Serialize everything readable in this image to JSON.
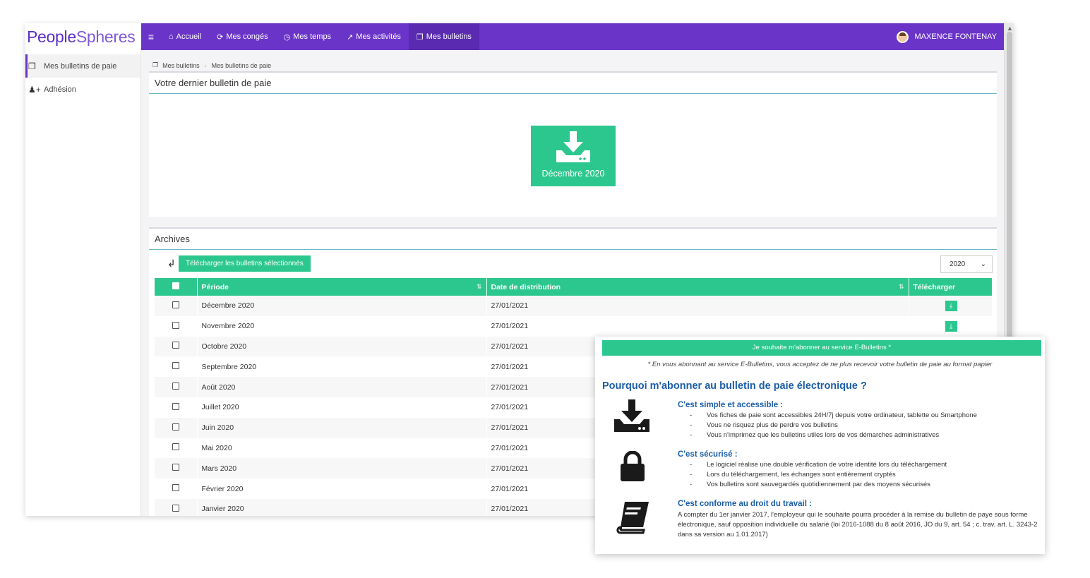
{
  "logo": {
    "part1": "Pe",
    "part2": "ople",
    "part3": "Spheres"
  },
  "nav": {
    "items": [
      {
        "icon": "home-icon",
        "glyph": "⌂",
        "label": "Accueil"
      },
      {
        "icon": "refresh-icon",
        "glyph": "⟳",
        "label": "Mes congés"
      },
      {
        "icon": "clock-icon",
        "glyph": "◷",
        "label": "Mes temps"
      },
      {
        "icon": "trend-icon",
        "glyph": "↗",
        "label": "Mes activités"
      },
      {
        "icon": "copy-icon",
        "glyph": "❐",
        "label": "Mes bulletins"
      }
    ],
    "user": "MAXENCE FONTENAY"
  },
  "sidebar": {
    "items": [
      {
        "label": "Mes bulletins de paie"
      },
      {
        "label": "Adhésion"
      }
    ]
  },
  "breadcrumb": {
    "root": "Mes bulletins",
    "current": "Mes bulletins de paie"
  },
  "latest": {
    "title": "Votre dernier bulletin de paie",
    "button": "Décembre 2020"
  },
  "archives": {
    "title": "Archives",
    "download_selected": "Télécharger les bulletins sélectionnés",
    "year": "2020",
    "columns": [
      "Période",
      "Date de distribution",
      "Télécharger"
    ],
    "rows": [
      {
        "period": "Décembre 2020",
        "date": "27/01/2021"
      },
      {
        "period": "Novembre 2020",
        "date": "27/01/2021"
      },
      {
        "period": "Octobre 2020",
        "date": "27/01/2021"
      },
      {
        "period": "Septembre 2020",
        "date": "27/01/2021"
      },
      {
        "period": "Août 2020",
        "date": "27/01/2021"
      },
      {
        "period": "Juillet 2020",
        "date": "27/01/2021"
      },
      {
        "period": "Juin 2020",
        "date": "27/01/2021"
      },
      {
        "period": "Mai 2020",
        "date": "27/01/2021"
      },
      {
        "period": "Mars 2020",
        "date": "27/01/2021"
      },
      {
        "period": "Février 2020",
        "date": "27/01/2021"
      },
      {
        "period": "Janvier 2020",
        "date": "27/01/2021"
      }
    ]
  },
  "card": {
    "subscribe_button": "Je souhaite m'abonner au service E-Bulletins *",
    "disclaimer": "* En vous abonnant au service E-Bulletins, vous acceptez de ne plus recevoir votre bulletin de paie au format papier",
    "title": "Pourquoi m'abonner au bulletin de paie électronique ?",
    "sections": [
      {
        "title": "C'est simple et accessible :",
        "items": [
          "Vos fiches de paie sont accessibles 24H/7j depuis votre ordinateur, tablette ou Smartphone",
          "Vous ne risquez plus de perdre vos bulletins",
          "Vous n'imprimez que les bulletins utiles lors de vos démarches administratives"
        ]
      },
      {
        "title": "C'est sécurisé :",
        "items": [
          "Le logiciel réalise une double vérification de votre identité lors du téléchargement",
          "Lors du téléchargement, les échanges sont entièrement cryptés",
          "Vos bulletins sont sauvegardés quotidiennement par des moyens sécurisés"
        ]
      },
      {
        "title": "C'est conforme au droit du travail :",
        "text": "A compter du 1er janvier 2017, l'employeur qui le souhaite pourra procéder à la remise du bulletin de paye sous forme électronique, sauf opposition individuelle du salarié (loi 2016-1088 du 8 août 2016, JO du 9, art. 54 ; c. trav. art. L. 3243-2 dans sa version au 1.01.2017)"
      }
    ]
  },
  "colors": {
    "brand": "#6a34c9",
    "accent": "#2cc78f",
    "heading": "#1b5ea8"
  }
}
